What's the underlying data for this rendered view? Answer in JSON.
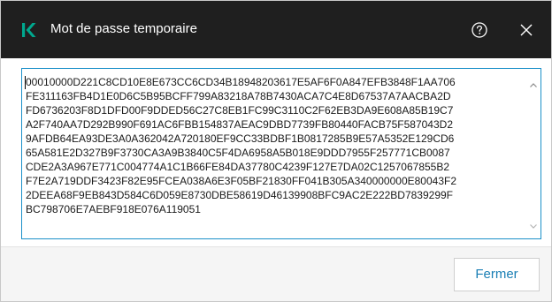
{
  "window": {
    "title": "Mot de passe temporaire",
    "logo_icon": "kaspersky-k-logo",
    "help_icon": "help-question-icon",
    "close_icon": "close-x-icon"
  },
  "colors": {
    "titlebar_bg": "#1f1f1f",
    "brand_green": "#00a88e",
    "accent_blue": "#1a7fb5",
    "focus_border": "#1b90c9"
  },
  "password_field": {
    "lines": [
      "00010000D221C8CD10E8E673CC6CD34B18948203617E5AF6F0A847EFB3848F1AA706",
      "FE311163FB4D1E0D6C5B95BCFF799A83218A78B7430ACA7C4E8D67537A7AACBA2D",
      "FD6736203F8D1DFD00F9DDED56C27C8EB1FC99C3110C2F62EB3DA9E608A85B19C7",
      "A2F740AA7D292B990F691AC6FBB154837AEAC9DBD7739FB80440FACB75F587043D2",
      "9AFDB64EA93DE3A0A362042A720180EF9CC33BDBF1B0817285B9E57A5352E129CD6",
      "65A581E2D327B9F3730CA3A9B3840C5F4DA6958A5B018E9DDD7955F257771CB0087",
      "CDE2A3A967E771C004774A1C1B66FE84DA37780C4239F127E7DA02C1257067855B2",
      "F7E2A719DDF3423F82E95FCEA038A6E3F05BF21830FF041B305A340000000E80043F2",
      "2DEEA68F9EB843D584C6D059E8730DBE58619D46139908BFC9AC2E222BD7839299F",
      "BC798706E7AEBF918E076A119051"
    ]
  },
  "footer": {
    "close_label": "Fermer"
  }
}
